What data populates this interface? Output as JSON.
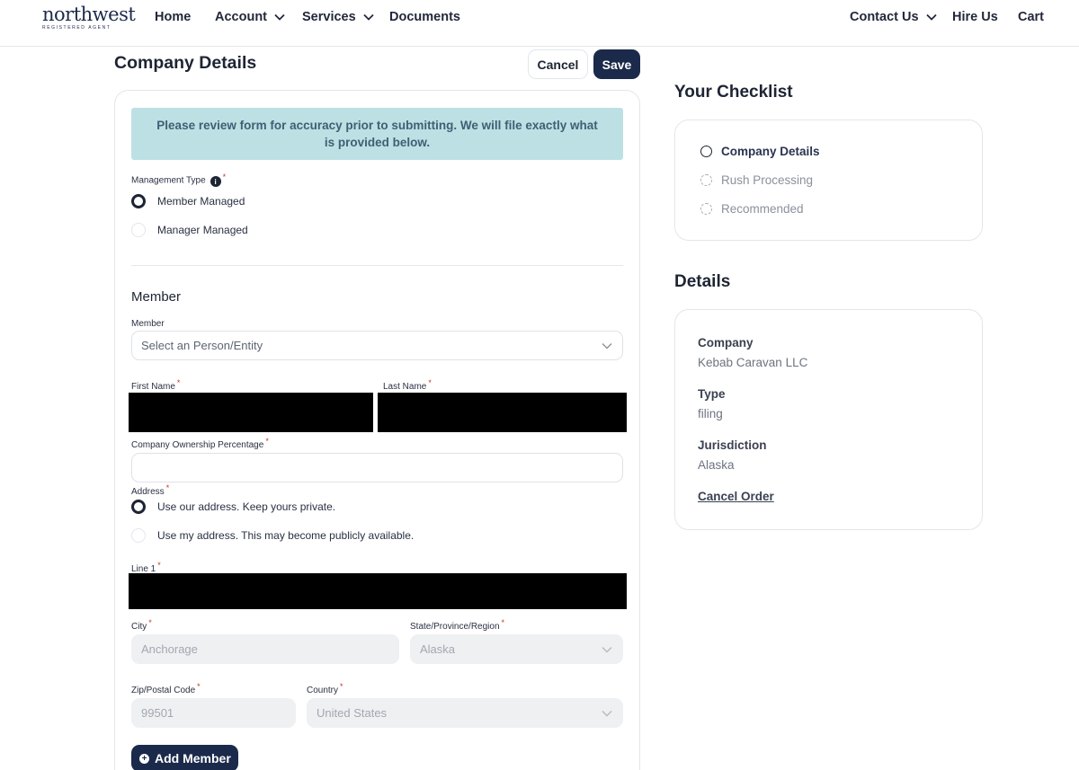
{
  "header": {
    "logo": {
      "brand": "northwest",
      "tagline": "REGISTERED AGENT"
    },
    "nav": [
      {
        "label": "Home"
      },
      {
        "label": "Account"
      },
      {
        "label": "Services"
      },
      {
        "label": "Documents"
      }
    ],
    "right_nav": [
      {
        "label": "Contact Us"
      },
      {
        "label": "Hire Us"
      },
      {
        "label": "Cart"
      }
    ]
  },
  "page": {
    "title": "Company Details",
    "cancel_label": "Cancel",
    "save_label": "Save"
  },
  "form": {
    "notice": "Please review form for accuracy prior to submitting. We will file exactly what is provided below.",
    "management_type": {
      "label": "Management Type",
      "options": [
        {
          "label": "Member Managed",
          "checked": true
        },
        {
          "label": "Manager Managed",
          "checked": false
        }
      ]
    },
    "member_section_title": "Member",
    "member_select": {
      "label": "Member",
      "placeholder": "Select an Person/Entity"
    },
    "first_name_label": "First Name",
    "last_name_label": "Last Name",
    "ownership_label": "Company Ownership Percentage",
    "address": {
      "label": "Address",
      "options": [
        {
          "label": "Use our address. Keep yours private.",
          "checked": true
        },
        {
          "label": "Use my address. This may become publicly available.",
          "checked": false
        }
      ]
    },
    "line1_label": "Line 1",
    "city": {
      "label": "City",
      "value": "Anchorage"
    },
    "state": {
      "label": "State/Province/Region",
      "value": "Alaska"
    },
    "zip": {
      "label": "Zip/Postal Code",
      "value": "99501"
    },
    "country": {
      "label": "Country",
      "value": "United States"
    },
    "add_member_label": "Add Member"
  },
  "checklist": {
    "title": "Your Checklist",
    "items": [
      {
        "label": "Company Details",
        "state": "active"
      },
      {
        "label": "Rush Processing",
        "state": "pending"
      },
      {
        "label": "Recommended",
        "state": "pending"
      }
    ]
  },
  "details": {
    "title": "Details",
    "company_label": "Company",
    "company_value": "Kebab Caravan LLC",
    "type_label": "Type",
    "type_value": "filing",
    "jurisdiction_label": "Jurisdiction",
    "jurisdiction_value": "Alaska",
    "cancel_order_label": "Cancel Order"
  },
  "colors": {
    "brand_navy": "#1b2a4a",
    "notice_bg": "#bde0e4",
    "required": "#c0392b"
  }
}
